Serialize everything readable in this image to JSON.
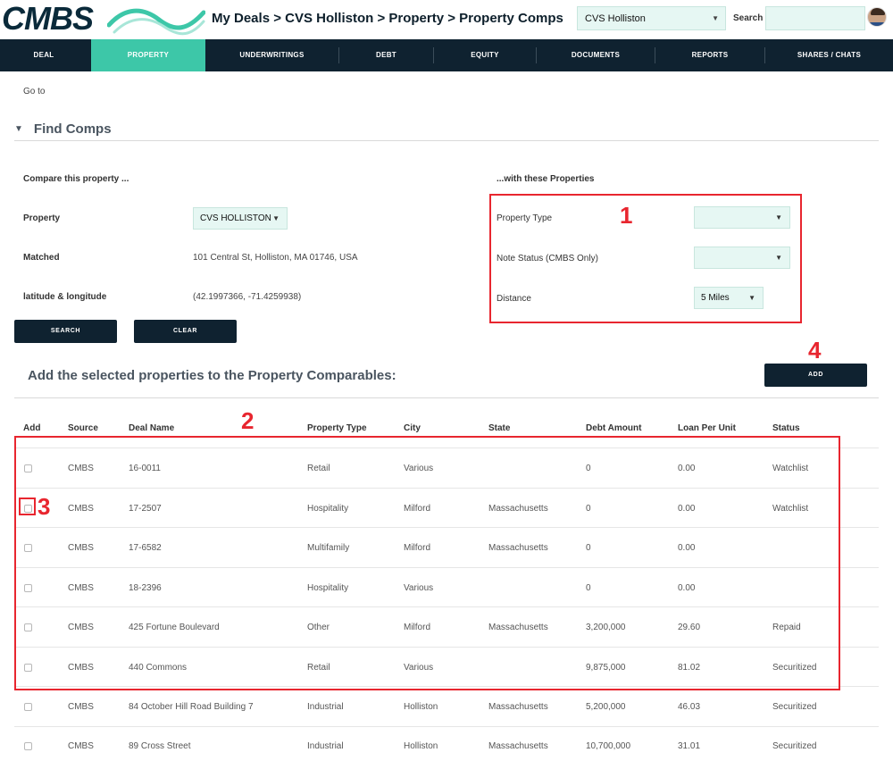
{
  "header": {
    "logo_text": "CMBS",
    "breadcrumb": "My Deals > CVS Holliston > Property > Property Comps",
    "deal_select_value": "CVS Holliston",
    "search_label": "Search",
    "search_value": ""
  },
  "nav": {
    "items": [
      {
        "label": "DEAL"
      },
      {
        "label": "PROPERTY"
      },
      {
        "label": "UNDERWRITINGS"
      },
      {
        "label": "DEBT"
      },
      {
        "label": "EQUITY"
      },
      {
        "label": "DOCUMENTS"
      },
      {
        "label": "REPORTS"
      },
      {
        "label": "SHARES / CHATS"
      }
    ],
    "active_index": 1
  },
  "goto_label": "Go to",
  "find_comps": {
    "title": "Find Comps",
    "left_heading": "Compare this property ...",
    "right_heading": "...with these Properties",
    "property_label": "Property",
    "property_value": "CVS HOLLISTON",
    "matched_label": "Matched",
    "matched_value": "101 Central St, Holliston, MA 01746, USA",
    "latlng_label": "latitude & longitude",
    "latlng_value": "(42.1997366, -71.4259938)",
    "property_type_label": "Property Type",
    "property_type_value": "",
    "note_status_label": "Note Status (CMBS Only)",
    "note_status_value": "",
    "distance_label": "Distance",
    "distance_value": "5 Miles",
    "search_button": "SEARCH",
    "clear_button": "CLEAR"
  },
  "add_section": {
    "title": "Add the selected properties to the Property Comparables:",
    "add_button": "ADD"
  },
  "markers": [
    "1",
    "2",
    "3",
    "4"
  ],
  "table": {
    "columns": [
      "Add",
      "Source",
      "Deal Name",
      "Property Type",
      "City",
      "State",
      "Debt Amount",
      "Loan Per Unit",
      "Status"
    ],
    "rows": [
      {
        "source": "CMBS",
        "deal": "16-0011",
        "type": "Retail",
        "city": "Various",
        "state": "",
        "debt": "0",
        "lpu": "0.00",
        "status": "Watchlist"
      },
      {
        "source": "CMBS",
        "deal": "17-2507",
        "type": "Hospitality",
        "city": "Milford",
        "state": "Massachusetts",
        "debt": "0",
        "lpu": "0.00",
        "status": "Watchlist"
      },
      {
        "source": "CMBS",
        "deal": "17-6582",
        "type": "Multifamily",
        "city": "Milford",
        "state": "Massachusetts",
        "debt": "0",
        "lpu": "0.00",
        "status": ""
      },
      {
        "source": "CMBS",
        "deal": "18-2396",
        "type": "Hospitality",
        "city": "Various",
        "state": "",
        "debt": "0",
        "lpu": "0.00",
        "status": ""
      },
      {
        "source": "CMBS",
        "deal": "425 Fortune Boulevard",
        "type": "Other",
        "city": "Milford",
        "state": "Massachusetts",
        "debt": "3,200,000",
        "lpu": "29.60",
        "status": "Repaid"
      },
      {
        "source": "CMBS",
        "deal": "440 Commons",
        "type": "Retail",
        "city": "Various",
        "state": "",
        "debt": "9,875,000",
        "lpu": "81.02",
        "status": "Securitized"
      },
      {
        "source": "CMBS",
        "deal": "84 October Hill Road Building 7",
        "type": "Industrial",
        "city": "Holliston",
        "state": "Massachusetts",
        "debt": "5,200,000",
        "lpu": "46.03",
        "status": "Securitized"
      },
      {
        "source": "CMBS",
        "deal": "89 Cross Street",
        "type": "Industrial",
        "city": "Holliston",
        "state": "Massachusetts",
        "debt": "10,700,000",
        "lpu": "31.01",
        "status": "Securitized"
      }
    ]
  },
  "colors": {
    "nav_bg": "#0f2230",
    "accent": "#3dc7a8",
    "annotation_red": "#e8262f",
    "select_bg": "#e6f7f3"
  }
}
